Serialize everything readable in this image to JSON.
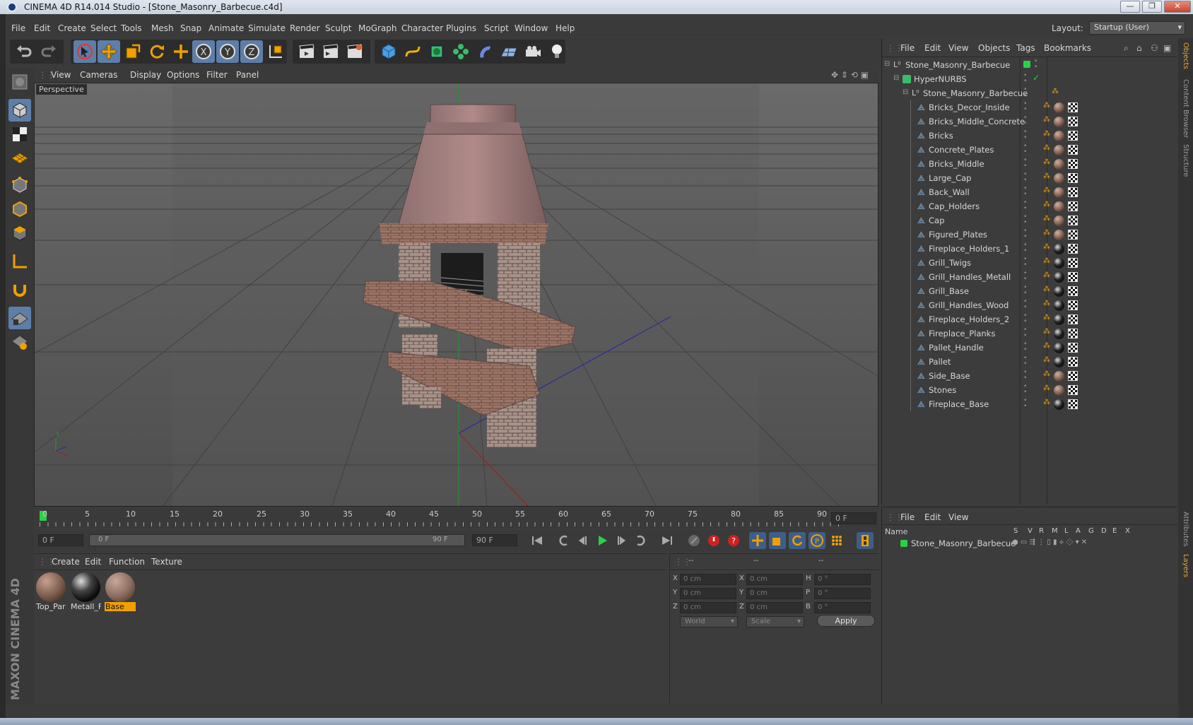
{
  "window": {
    "title": "CINEMA 4D R14.014 Studio - [Stone_Masonry_Barbecue.c4d]",
    "min": "—",
    "max": "❐",
    "close": "✕"
  },
  "menu": {
    "items": [
      "File",
      "Edit",
      "Create",
      "Select",
      "Tools",
      "Mesh",
      "Snap",
      "Animate",
      "Simulate",
      "Render",
      "Sculpt",
      "MoGraph",
      "Character",
      "Plugins",
      "Script",
      "Window",
      "Help"
    ],
    "layout_label": "Layout:",
    "layout_value": "Startup (User)"
  },
  "viewport": {
    "menu": [
      "View",
      "Cameras",
      "Display",
      "Options",
      "Filter",
      "Panel"
    ],
    "label": "Perspective"
  },
  "timeline": {
    "ticks": [
      "0",
      "5",
      "10",
      "15",
      "20",
      "25",
      "30",
      "35",
      "40",
      "45",
      "50",
      "55",
      "60",
      "65",
      "70",
      "75",
      "80",
      "85",
      "90"
    ],
    "frame_field": "0 F",
    "start_field": "0 F",
    "range_start": "0 F",
    "range_end": "90 F",
    "end_field": "90 F"
  },
  "materials": {
    "menu": [
      "Create",
      "Edit",
      "Function",
      "Texture"
    ],
    "items": [
      {
        "name": "Top_Par",
        "color": "#8a6a5a"
      },
      {
        "name": "Metall_F",
        "color": "#2a2a2a"
      },
      {
        "name": "Base",
        "color": "#7a5e52"
      }
    ]
  },
  "coords": {
    "header": [
      "--",
      "--",
      "--"
    ],
    "rows": [
      {
        "a": "X",
        "av": "0 cm",
        "b": "X",
        "bv": "0 cm",
        "c": "H",
        "cv": "0 °"
      },
      {
        "a": "Y",
        "av": "0 cm",
        "b": "Y",
        "bv": "0 cm",
        "c": "P",
        "cv": "0 °"
      },
      {
        "a": "Z",
        "av": "0 cm",
        "b": "Z",
        "bv": "0 cm",
        "c": "B",
        "cv": "0 °"
      }
    ],
    "world": "World",
    "scale": "Scale",
    "apply": "Apply"
  },
  "objects": {
    "menu": [
      "File",
      "Edit",
      "View",
      "Objects",
      "Tags",
      "Bookmarks"
    ],
    "root": "Stone_Masonry_Barbecue",
    "nurbs": "HyperNURBS",
    "group": "Stone_Masonry_Barbecue",
    "children": [
      {
        "name": "Bricks_Decor_Inside",
        "dark": false
      },
      {
        "name": "Bricks_Middle_Concrete",
        "dark": false
      },
      {
        "name": "Bricks",
        "dark": false
      },
      {
        "name": "Concrete_Plates",
        "dark": false
      },
      {
        "name": "Bricks_Middle",
        "dark": false
      },
      {
        "name": "Large_Cap",
        "dark": false
      },
      {
        "name": "Back_Wall",
        "dark": false
      },
      {
        "name": "Cap_Holders",
        "dark": false
      },
      {
        "name": "Cap",
        "dark": false
      },
      {
        "name": "Figured_Plates",
        "dark": false
      },
      {
        "name": "Fireplace_Holders_1",
        "dark": true
      },
      {
        "name": "Grill_Twigs",
        "dark": true
      },
      {
        "name": "Grill_Handles_Metall",
        "dark": true
      },
      {
        "name": "Grill_Base",
        "dark": true
      },
      {
        "name": "Grill_Handles_Wood",
        "dark": true
      },
      {
        "name": "Fireplace_Holders_2",
        "dark": true
      },
      {
        "name": "Fireplace_Planks",
        "dark": true
      },
      {
        "name": "Pallet_Handle",
        "dark": true
      },
      {
        "name": "Pallet",
        "dark": true
      },
      {
        "name": "Side_Base",
        "dark": false
      },
      {
        "name": "Stones",
        "dark": false
      },
      {
        "name": "Fireplace_Base",
        "dark": true
      }
    ]
  },
  "layers": {
    "menu": [
      "File",
      "Edit",
      "View"
    ],
    "col_name": "Name",
    "cols": [
      "S",
      "V",
      "R",
      "M",
      "L",
      "A",
      "G",
      "D",
      "E",
      "X"
    ],
    "row": "Stone_Masonry_Barbecue"
  },
  "side_tabs": [
    "Objects",
    "Content Browser",
    "Structure"
  ],
  "side_tabs2": [
    "Attributes",
    "Layers"
  ],
  "brand": "MAXON CINEMA 4D"
}
